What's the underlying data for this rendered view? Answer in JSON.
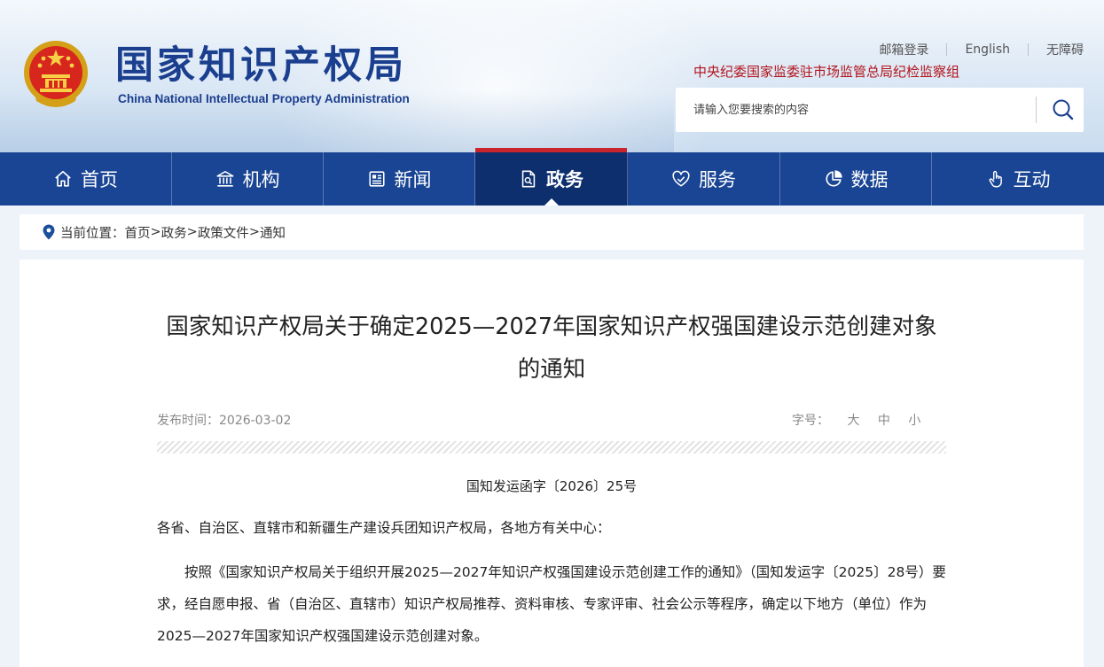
{
  "header": {
    "logo_cn": "国家知识产权局",
    "logo_en": "China National Intellectual Property Administration",
    "top_links": [
      "邮箱登录",
      "English",
      "无障碍"
    ],
    "discipline_text": "中央纪委国家监委驻市场监管总局纪检监察组",
    "search_placeholder": "请输入您要搜索的内容"
  },
  "nav": {
    "items": [
      {
        "label": "首页",
        "icon": "home-icon"
      },
      {
        "label": "机构",
        "icon": "institution-icon"
      },
      {
        "label": "新闻",
        "icon": "news-icon"
      },
      {
        "label": "政务",
        "icon": "government-affairs-icon",
        "active": true
      },
      {
        "label": "服务",
        "icon": "service-icon"
      },
      {
        "label": "数据",
        "icon": "data-pie-icon"
      },
      {
        "label": "互动",
        "icon": "interaction-hand-icon"
      }
    ]
  },
  "breadcrumb": {
    "prefix": "当前位置：",
    "items": [
      "首页",
      "政务",
      "政策文件",
      "通知"
    ],
    "separator": ">"
  },
  "article": {
    "title_line1": "国家知识产权局关于确定2025—2027年国家知识产权强国建设示范创建对象",
    "title_line2": "的通知",
    "date_label": "发布时间：",
    "date": "2026-03-02",
    "font_size_label": "字号：",
    "font_sizes": [
      "大",
      "中",
      "小"
    ],
    "doc_number": "国知发运函字〔2026〕25号",
    "addressee": "各省、自治区、直辖市和新疆生产建设兵团知识产权局，各地方有关中心：",
    "paragraph1": "按照《国家知识产权局关于组织开展2025—2027年知识产权强国建设示范创建工作的通知》（国知发运字〔2025〕28号）要求，经自愿申报、省（自治区、直辖市）知识产权局推荐、资料审核、专家评审、社会公示等程序，确定以下地方（单位）作为2025—2027年国家知识产权强国建设示范创建对象。"
  },
  "colors": {
    "nav_bg": "#194594",
    "nav_active_bg": "#0e2f6e",
    "active_marker": "#c8262c",
    "logo_blue": "#1b3f8f",
    "discipline_red": "#b3131a"
  }
}
